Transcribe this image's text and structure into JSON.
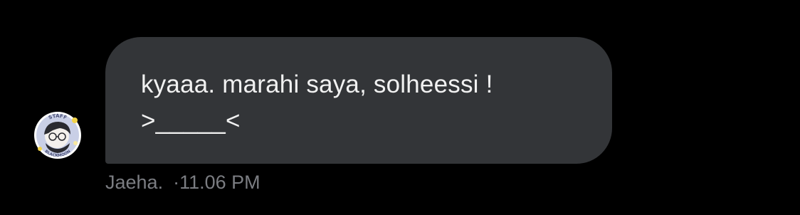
{
  "message": {
    "text_line1": "kyaaa. marahi saya, solheessi !",
    "text_line2": ">_____<",
    "sender": "Jaeha.",
    "separator": "·",
    "time": "11.06 PM",
    "avatar_icon": "sticker-avatar-icon",
    "avatar_text_top": "STAFF",
    "avatar_text_bottom": "BLACKMOON"
  },
  "colors": {
    "background": "#000000",
    "bubble": "#333538",
    "text": "#f1f1f1",
    "meta": "#7b7d82"
  }
}
